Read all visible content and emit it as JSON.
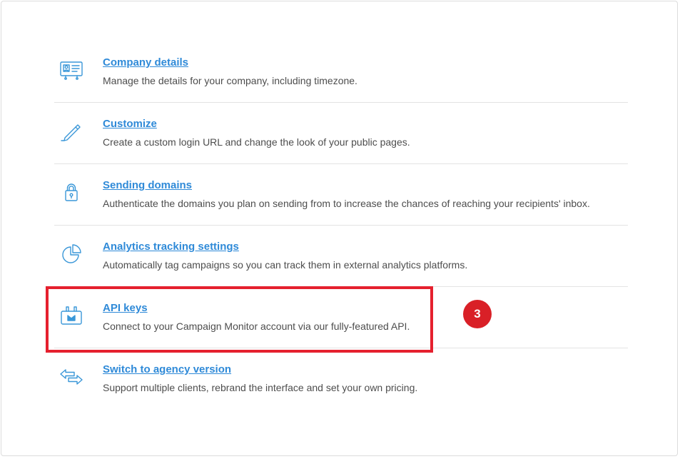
{
  "settings": {
    "items": [
      {
        "icon": "id-card-icon",
        "title": "Company details",
        "description": "Manage the details for your company, including timezone."
      },
      {
        "icon": "pencil-icon",
        "title": "Customize",
        "description": "Create a custom login URL and change the look of your public pages."
      },
      {
        "icon": "lock-icon",
        "title": "Sending domains",
        "description": "Authenticate the domains you plan on sending from to increase the chances of reaching your recipients' inbox."
      },
      {
        "icon": "pie-chart-icon",
        "title": "Analytics tracking settings",
        "description": "Automatically tag campaigns so you can track them in external analytics platforms."
      },
      {
        "icon": "api-plug-icon",
        "title": "API keys",
        "description": "Connect to your Campaign Monitor account via our fully-featured API."
      },
      {
        "icon": "switch-arrows-icon",
        "title": "Switch to agency version",
        "description": "Support multiple clients, rebrand the interface and set your own pricing."
      }
    ]
  },
  "annotation": {
    "step_number": "3",
    "highlight_color": "#e5202e",
    "badge_color": "#d92027"
  },
  "colors": {
    "link": "#2f8ad8",
    "icon": "#3a97d8",
    "text": "#4d4d4d"
  }
}
